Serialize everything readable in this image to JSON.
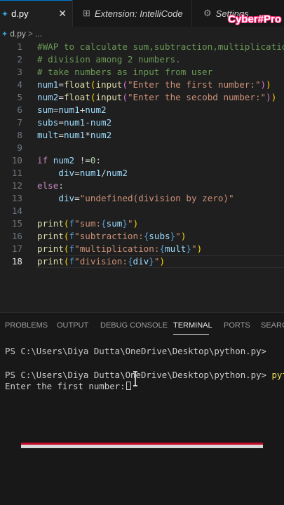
{
  "tabs": [
    {
      "label": "d.py",
      "active": true,
      "icon": "python-file-icon"
    },
    {
      "label": "Extension: IntelliCode",
      "active": false,
      "icon": "extension-icon"
    },
    {
      "label": "Settings",
      "active": false,
      "icon": "gear-icon"
    }
  ],
  "tab_close": "✕",
  "watermark": "Cyber#Pro",
  "breadcrumb": {
    "file": "d.py",
    "separator": ">",
    "more": "..."
  },
  "editor": {
    "current_line": 18,
    "lines": [
      {
        "n": "1",
        "text": "#WAP to calculate sum,subtraction,multiplication"
      },
      {
        "n": "2",
        "text": "# division among 2 numbers."
      },
      {
        "n": "3",
        "text": "# take numbers as input from user"
      },
      {
        "n": "4",
        "text": "num1=float(input(\"Enter the first number:\"))"
      },
      {
        "n": "5",
        "text": "num2=float(input(\"Enter the secobd number:\"))"
      },
      {
        "n": "6",
        "text": "sum=num1+num2"
      },
      {
        "n": "7",
        "text": "subs=num1-num2"
      },
      {
        "n": "8",
        "text": "mult=num1*num2"
      },
      {
        "n": "9",
        "text": ""
      },
      {
        "n": "10",
        "text": "if num2 !=0:"
      },
      {
        "n": "11",
        "text": "    div=num1/num2"
      },
      {
        "n": "12",
        "text": "else:"
      },
      {
        "n": "13",
        "text": "    div=\"undefined(division by zero)\""
      },
      {
        "n": "14",
        "text": ""
      },
      {
        "n": "15",
        "text": "print(f\"sum:{sum}\")"
      },
      {
        "n": "16",
        "text": "print(f\"subtraction:{subs}\")"
      },
      {
        "n": "17",
        "text": "print(f\"multiplication:{mult}\")"
      },
      {
        "n": "18",
        "text": "print(f\"division:{div}\")"
      }
    ]
  },
  "panel": {
    "tabs": [
      "PROBLEMS",
      "OUTPUT",
      "DEBUG CONSOLE",
      "TERMINAL",
      "PORTS",
      "SEARCH"
    ],
    "active_tab": "TERMINAL"
  },
  "terminal": {
    "line1": "PS C:\\Users\\Diya Dutta\\OneDrive\\Desktop\\python.py>",
    "line2_prompt": "PS C:\\Users\\Diya Dutta\\OneDrive\\Desktop\\python.py>",
    "line2_cmd": "python",
    "line3": "Enter the first number:"
  },
  "colors": {
    "editor_bg": "#1f1f1f",
    "panel_bg": "#181818",
    "accent": "#0078d4",
    "progress_track": "#d8d8d8",
    "progress_fill": "#c40a2a"
  },
  "progress": {
    "fraction": 1.0
  }
}
